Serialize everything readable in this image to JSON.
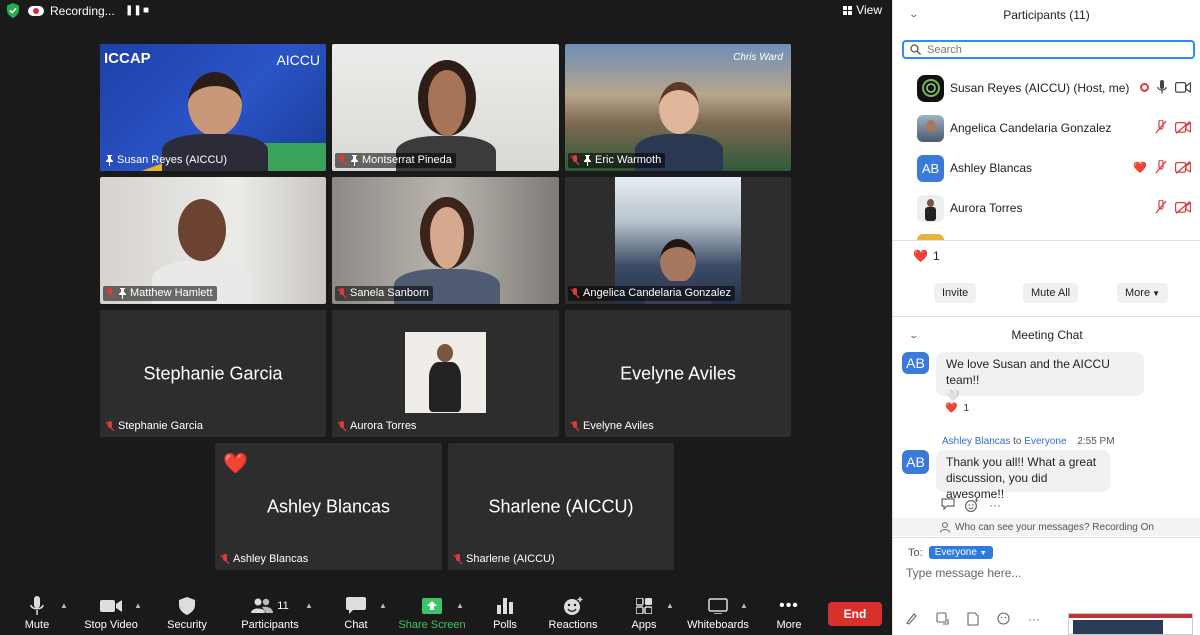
{
  "topbar": {
    "recording_label": "Recording...",
    "pause_glyph": "❚❚",
    "stop_glyph": "■",
    "view_label": "View"
  },
  "tiles": [
    {
      "name": "Susan Reyes (AICCU)",
      "video": true,
      "muted": false,
      "pinned": true
    },
    {
      "name": "Montserrat Pineda",
      "video": true,
      "muted": true,
      "pinned": true
    },
    {
      "name": "Eric Warmoth",
      "video": true,
      "muted": true,
      "pinned": true
    },
    {
      "name": "Matthew Hamlett",
      "video": true,
      "muted": true,
      "pinned": true
    },
    {
      "name": "Sanela Sanborn",
      "video": true,
      "muted": true,
      "pinned": false
    },
    {
      "name": "Angelica Candelaria Gonzalez",
      "video": true,
      "muted": true,
      "pinned": false
    },
    {
      "name": "Stephanie Garcia",
      "video": false,
      "muted": true,
      "pinned": false
    },
    {
      "name": "Aurora Torres",
      "video": true,
      "muted": true,
      "pinned": false
    },
    {
      "name": "Evelyne Aviles",
      "video": false,
      "muted": true,
      "pinned": false
    },
    {
      "name": "Ashley Blancas",
      "video": false,
      "muted": true,
      "pinned": false,
      "reaction": "❤️"
    },
    {
      "name": "Sharlene (AICCU)",
      "video": false,
      "muted": true,
      "pinned": false
    }
  ],
  "tile_logos": {
    "iccap": "ICCAP",
    "aiccu": "AICCU",
    "chris_ward": "Chris Ward"
  },
  "toolbar": {
    "mute": "Mute",
    "stop_video": "Stop Video",
    "security": "Security",
    "participants": "Participants",
    "participants_count": "11",
    "chat": "Chat",
    "share_screen": "Share Screen",
    "polls": "Polls",
    "reactions": "Reactions",
    "apps": "Apps",
    "whiteboards": "Whiteboards",
    "more": "More",
    "end": "End"
  },
  "participants_panel": {
    "title": "Participants (11)",
    "search_placeholder": "Search",
    "list": [
      {
        "name": "Susan Reyes (AICCU) (Host, me)",
        "avatar": "",
        "reaction": ""
      },
      {
        "name": "Angelica Candelaria Gonzalez",
        "avatar": "",
        "reaction": ""
      },
      {
        "name": "Ashley Blancas",
        "avatar": "AB",
        "reaction": "❤️"
      },
      {
        "name": "Aurora Torres",
        "avatar": "",
        "reaction": ""
      }
    ],
    "reaction_summary": {
      "emoji": "❤️",
      "count": "1"
    },
    "buttons": {
      "invite": "Invite",
      "mute_all": "Mute All",
      "more": "More"
    }
  },
  "chat": {
    "title": "Meeting Chat",
    "messages": [
      {
        "avatar": "AB",
        "text": "We love Susan and the AICCU team!!",
        "emoji": "🤍",
        "reaction": "❤️",
        "reaction_count": "1"
      },
      {
        "avatar": "AB",
        "sender": "Ashley Blancas",
        "to_word": "to",
        "recipient": "Everyone",
        "time": "2:55 PM",
        "line1": "Thank you all!! What a great",
        "line2": "discussion, you did awesome!!"
      }
    ],
    "visibility_notice": "Who can see your messages? Recording On",
    "to_label": "To:",
    "to_value": "Everyone",
    "input_placeholder": "Type message here..."
  },
  "colors": {
    "active_speaker": "#6ebd4e",
    "end_button": "#d8312b",
    "share_green": "#3ec36a",
    "accent_blue": "#2d8cff",
    "avatar_blue": "#3c7ad9"
  }
}
